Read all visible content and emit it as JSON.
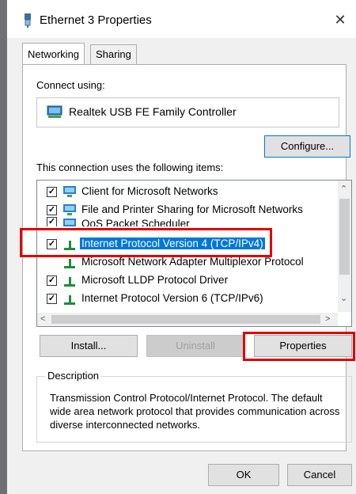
{
  "window": {
    "title": "Ethernet 3 Properties",
    "close_glyph": "✕"
  },
  "tabs": [
    {
      "label": "Networking",
      "active": true
    },
    {
      "label": "Sharing",
      "active": false
    }
  ],
  "connect": {
    "label": "Connect using:",
    "adapter": "Realtek USB FE Family Controller",
    "configure_label": "Configure..."
  },
  "items_label": "This connection uses the following items:",
  "items": [
    {
      "label": "Client for Microsoft Networks",
      "checked": true,
      "icon": "network-client-icon"
    },
    {
      "label": "File and Printer Sharing for Microsoft Networks",
      "checked": true,
      "icon": "network-service-icon"
    },
    {
      "label": "QoS Packet Scheduler",
      "checked": true,
      "icon": "network-service-icon"
    },
    {
      "label": "Internet Protocol Version 4 (TCP/IPv4)",
      "checked": true,
      "icon": "protocol-icon",
      "selected": true
    },
    {
      "label": "Microsoft Network Adapter Multiplexor Protocol",
      "checked": false,
      "icon": "protocol-icon"
    },
    {
      "label": "Microsoft LLDP Protocol Driver",
      "checked": true,
      "icon": "protocol-icon"
    },
    {
      "label": "Internet Protocol Version 6 (TCP/IPv6)",
      "checked": true,
      "icon": "protocol-icon"
    }
  ],
  "buttons": {
    "install": "Install...",
    "uninstall": "Uninstall",
    "properties": "Properties",
    "ok": "OK",
    "cancel": "Cancel"
  },
  "description": {
    "label": "Description",
    "text": "Transmission Control Protocol/Internet Protocol. The default wide area network protocol that provides communication across diverse interconnected networks."
  },
  "colors": {
    "selection": "#0078d7",
    "highlight": "#e10000"
  }
}
